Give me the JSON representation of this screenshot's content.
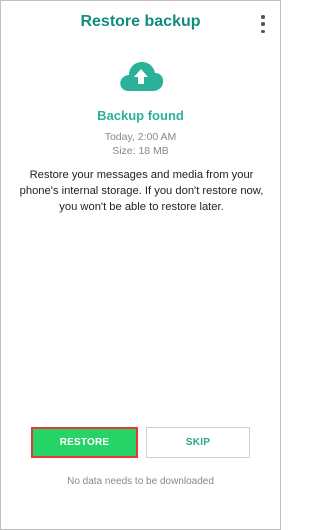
{
  "header": {
    "title": "Restore backup",
    "menu_icon": "more-vert-icon"
  },
  "backup": {
    "icon": "cloud-upload-icon",
    "heading": "Backup found",
    "time": "Today, 2:00 AM",
    "size": "Size: 18 MB",
    "description": "Restore your messages and media from your phone's internal storage. If you don't restore now, you won't be able to restore later."
  },
  "actions": {
    "restore_label": "RESTORE",
    "skip_label": "SKIP"
  },
  "footer": {
    "note": "No data needs to be downloaded"
  },
  "colors": {
    "brand_teal": "#128c7e",
    "accent_green": "#25d366",
    "light_teal": "#2bb19a",
    "highlight_red": "#e23a3a"
  }
}
